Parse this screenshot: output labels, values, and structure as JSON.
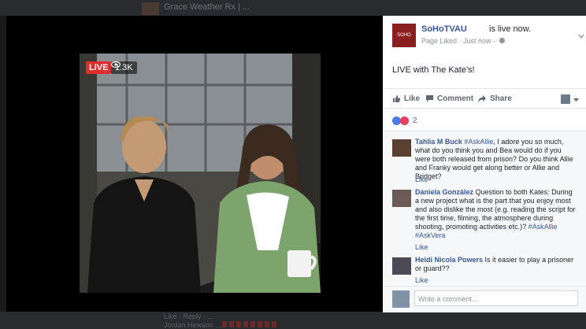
{
  "background": {
    "top_text": "Grace Weather Rx | ...",
    "bottom_line1": "Like · Reply · ...",
    "bottom_line2": "Jordan Hewson ..."
  },
  "video": {
    "live_label": "LIVE",
    "viewer_count": "1.3K"
  },
  "post": {
    "page_avatar_text": "SOHO",
    "page_name": "SoHoTVAU",
    "status": "is live now.",
    "meta": "Page Liked · Just now ·",
    "text": "LIVE with The Kate's!"
  },
  "actions": {
    "like": "Like",
    "comment": "Comment",
    "share": "Share"
  },
  "reactions": {
    "count": "2"
  },
  "comments": [
    {
      "name": "Tahlia M Buck",
      "tag": "#AskAllie",
      "text": ", I adore you so much, what do you think you and Bea would do if you were both released from prison? Do you think Allie and Franky would get along better or Allie and Bridget?",
      "like": "Like"
    },
    {
      "name": "Daniela González",
      "text": "Question to both Kates: During a new project what is the part that you enjoy most and also dislike the most (e.g. reading the script for the first time, filming, the atmosphere during shooting, promoting activities etc.)?",
      "tag1": "#AskAllie",
      "tag2": "#AskVera",
      "like": "Like"
    },
    {
      "name": "Heidi Nicola Powers",
      "text": "Is it easier to play a prisoner or guard??",
      "like": "Like"
    }
  ],
  "write_comment": {
    "placeholder": "Write a comment..."
  },
  "colors": {
    "live": "#e02c2c",
    "link": "#365899",
    "panel_bg": "#ffffff"
  }
}
